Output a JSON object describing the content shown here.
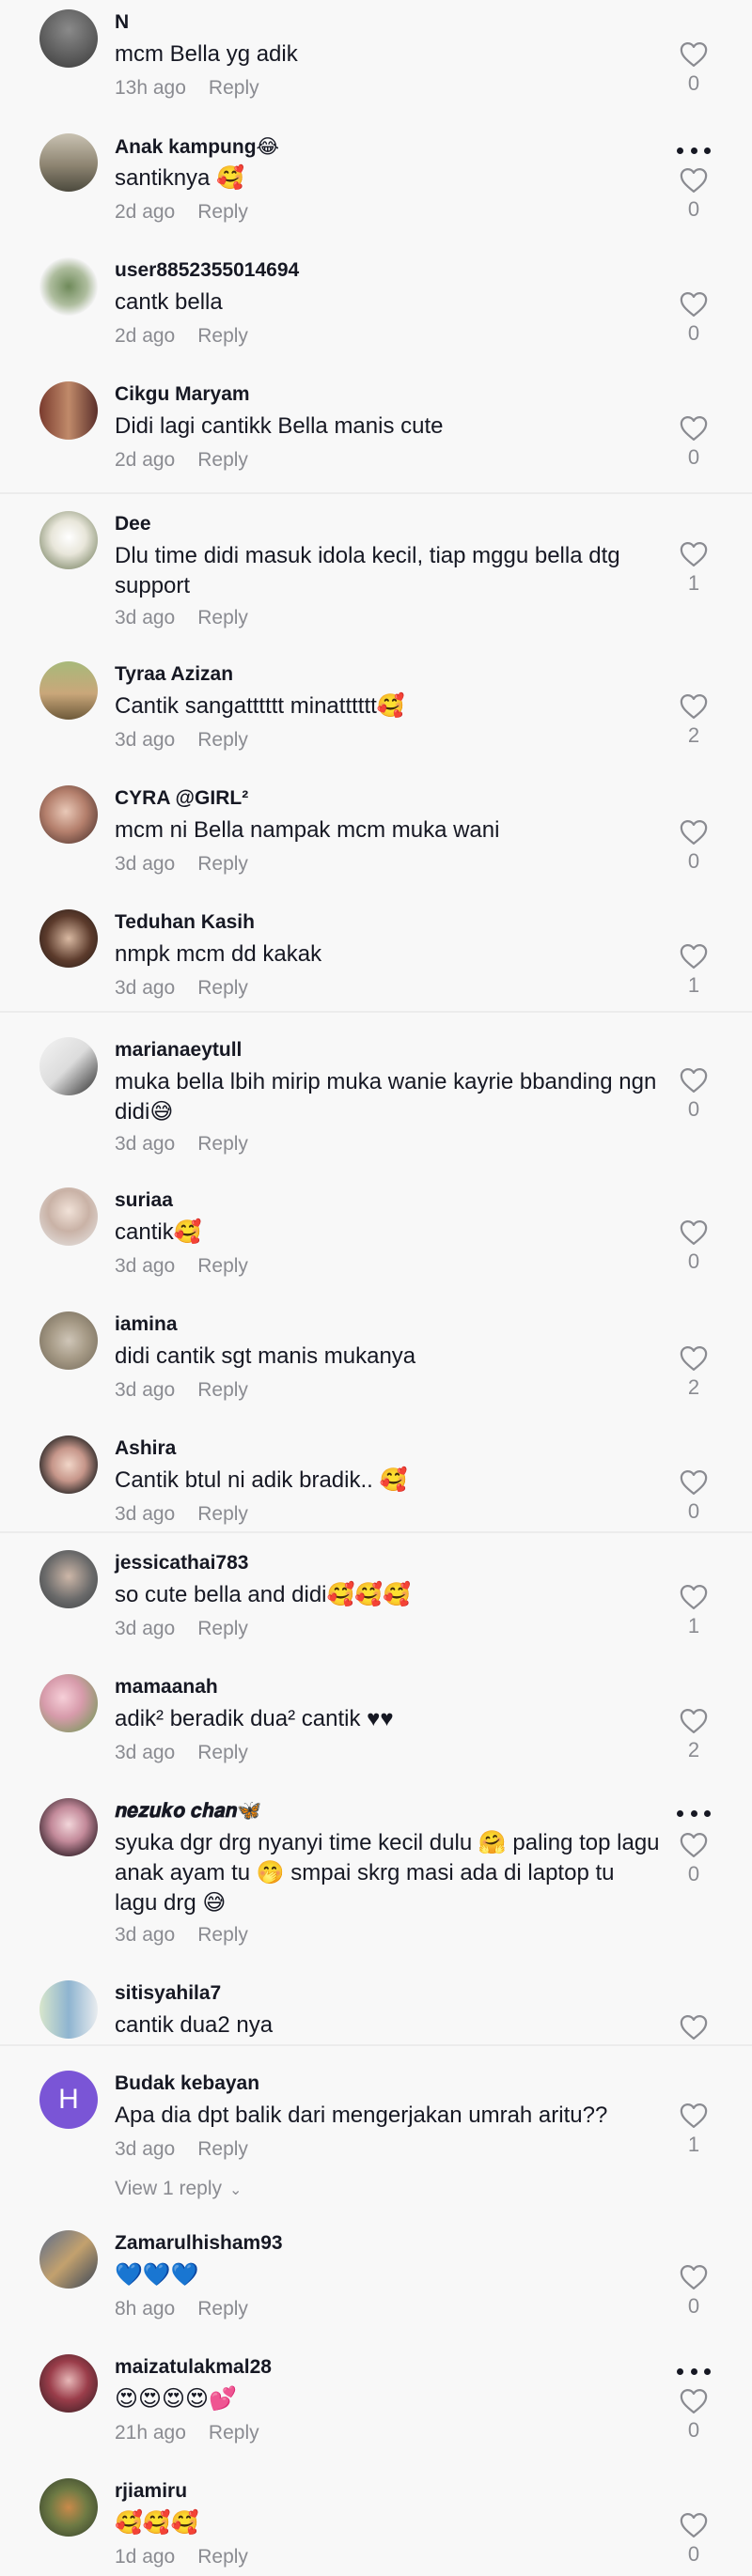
{
  "colors": {
    "background": "#f8f8f8",
    "username": "#161823",
    "meta_gray": "#8a8b91",
    "like_outline": "#8a8b91",
    "avatar_letter_bg": "#7a55d6"
  },
  "comments": [
    {
      "username": "N",
      "text": "mcm Bella yg adik",
      "time": "13h ago",
      "reply_label": "Reply",
      "likes": "0",
      "has_more": false
    },
    {
      "username": "Anak kampung😂",
      "text": "santiknya 🥰",
      "time": "2d ago",
      "reply_label": "Reply",
      "likes": "0",
      "has_more": true
    },
    {
      "username": "user8852355014694",
      "text": "cantk bella",
      "time": "2d ago",
      "reply_label": "Reply",
      "likes": "0",
      "has_more": false
    },
    {
      "username": "Cikgu Maryam",
      "text": "Didi lagi cantikk Bella manis cute",
      "time": "2d ago",
      "reply_label": "Reply",
      "likes": "0",
      "has_more": false
    },
    {
      "username": "Dee",
      "text": "Dlu time didi masuk idola kecil, tiap mggu bella dtg support",
      "time": "3d ago",
      "reply_label": "Reply",
      "likes": "1",
      "has_more": false
    },
    {
      "username": "Tyraa Azizan",
      "text": "Cantik sangatttttt minatttttt🥰",
      "time": "3d ago",
      "reply_label": "Reply",
      "likes": "2",
      "has_more": false
    },
    {
      "username": "CYRA @GIRL²",
      "text": "mcm ni Bella nampak mcm muka wani",
      "time": "3d ago",
      "reply_label": "Reply",
      "likes": "0",
      "has_more": false
    },
    {
      "username": "Teduhan Kasih",
      "text": "nmpk mcm dd kakak",
      "time": "3d ago",
      "reply_label": "Reply",
      "likes": "1",
      "has_more": false
    },
    {
      "username": "marianaeytull",
      "text": "muka bella lbih mirip muka wanie kayrie bbanding ngn didi😅",
      "time": "3d ago",
      "reply_label": "Reply",
      "likes": "0",
      "has_more": false
    },
    {
      "username": "suriaa",
      "text": "cantik🥰",
      "time": "3d ago",
      "reply_label": "Reply",
      "likes": "0",
      "has_more": false
    },
    {
      "username": "iamina",
      "text": "didi cantik sgt manis mukanya",
      "time": "3d ago",
      "reply_label": "Reply",
      "likes": "2",
      "has_more": false
    },
    {
      "username": "Ashira",
      "text": "Cantik btul ni adik bradik.. 🥰",
      "time": "3d ago",
      "reply_label": "Reply",
      "likes": "0",
      "has_more": false
    },
    {
      "username": "jessicathai783",
      "text": "so cute bella and didi🥰🥰🥰",
      "time": "3d ago",
      "reply_label": "Reply",
      "likes": "1",
      "has_more": false
    },
    {
      "username": "mamaanah",
      "text": "adik² beradik dua² cantik ♥♥",
      "time": "3d ago",
      "reply_label": "Reply",
      "likes": "2",
      "has_more": false
    },
    {
      "username": "𝒏𝒆𝒛𝒖𝒌𝒐 𝒄𝒉𝒂𝒏🦋",
      "text": "syuka dgr drg nyanyi time kecil dulu 🤗 paling top lagu anak ayam tu 🤭 smpai skrg masi ada di laptop tu lagu drg 😅",
      "time": "3d ago",
      "reply_label": "Reply",
      "likes": "0",
      "has_more": true
    },
    {
      "username": "sitisyahila7",
      "text": "cantik dua2 nya",
      "time": "",
      "reply_label": "",
      "likes": "",
      "has_more": false
    },
    {
      "username": "Budak kebayan",
      "avatar_letter": "H",
      "text": "Apa dia dpt balik dari mengerjakan umrah aritu??",
      "time": "3d ago",
      "reply_label": "Reply",
      "likes": "1",
      "view_replies": "View 1 reply",
      "has_more": false
    },
    {
      "username": "Zamarulhisham93",
      "text": "💙💙💙",
      "time": "8h ago",
      "reply_label": "Reply",
      "likes": "0",
      "has_more": false
    },
    {
      "username": "maizatulakmal28",
      "text": "😍😍😍😍💕",
      "time": "21h ago",
      "reply_label": "Reply",
      "likes": "0",
      "has_more": true
    },
    {
      "username": "rjiamiru",
      "text": "🥰🥰🥰",
      "time": "1d ago",
      "reply_label": "Reply",
      "likes": "0",
      "has_more": false
    }
  ]
}
